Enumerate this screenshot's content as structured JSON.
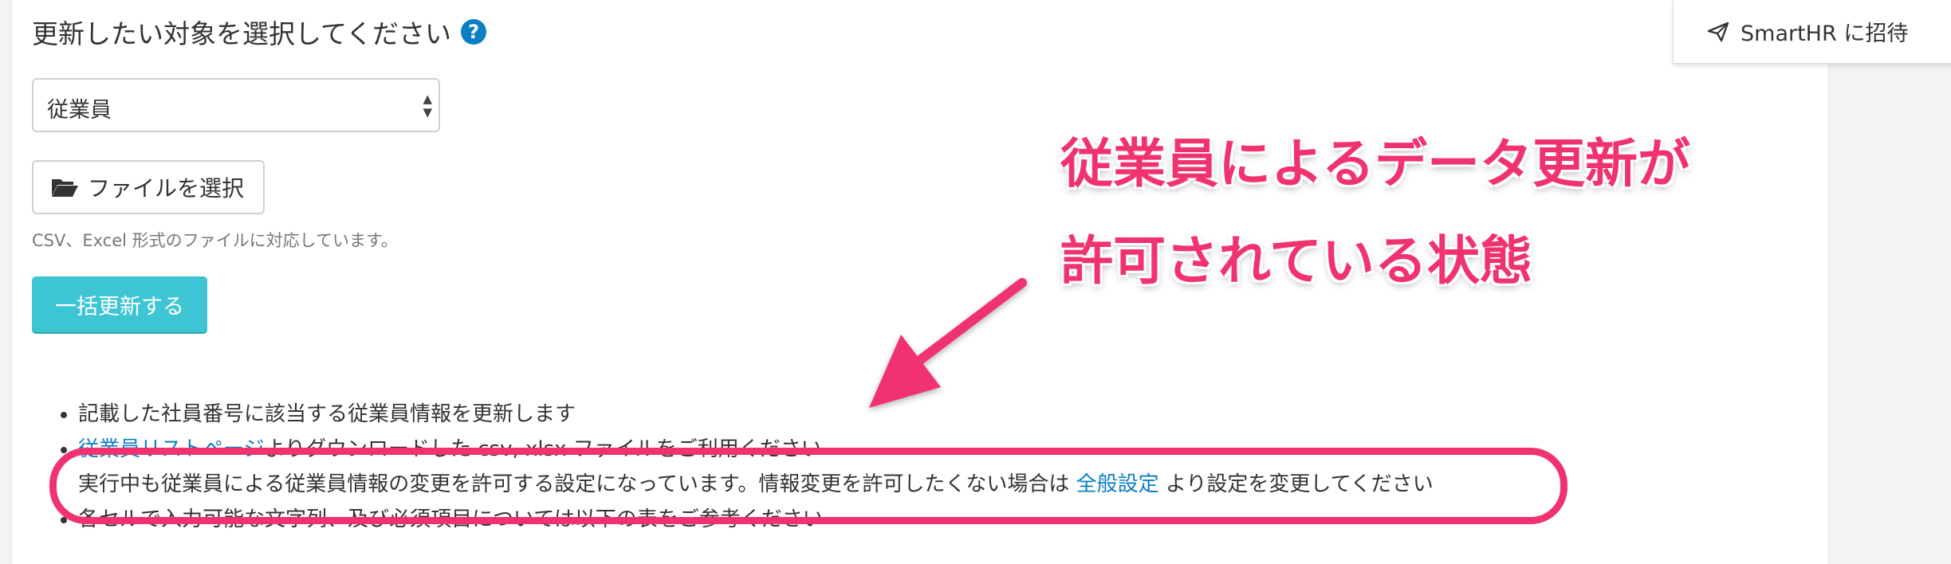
{
  "heading": {
    "text": "更新したい対象を選択してください",
    "help_icon": "?"
  },
  "target_select": {
    "value": "従業員"
  },
  "file_button": {
    "label": "ファイルを選択",
    "icon": "folder-open-icon"
  },
  "file_hint": "CSV、Excel 形式のファイルに対応しています。",
  "bulk_update_button": {
    "label": "一括更新する",
    "color": "#3ec5d3"
  },
  "notes": {
    "item1": "記載した社員番号に該当する従業員情報を更新します",
    "item2_link": "従業員リストページ",
    "item2_rest": "よりダウンロードした csv, xlsx ファイルをご利用ください",
    "item3_pre": "実行中も従業員による従業員情報の変更を許可する設定になっています。情報変更を許可したくない場合は ",
    "item3_link": "全般設定",
    "item3_post": " より設定を変更してください",
    "item4": "各セルで入力可能な文字列、及び必須項目については以下の表をご参考ください"
  },
  "invite_button": {
    "label": "SmartHR に招待",
    "icon": "send-icon"
  },
  "annotation": {
    "line1": "従業員によるデータ更新が",
    "line2": "許可されている状態",
    "color": "#f0336f"
  }
}
